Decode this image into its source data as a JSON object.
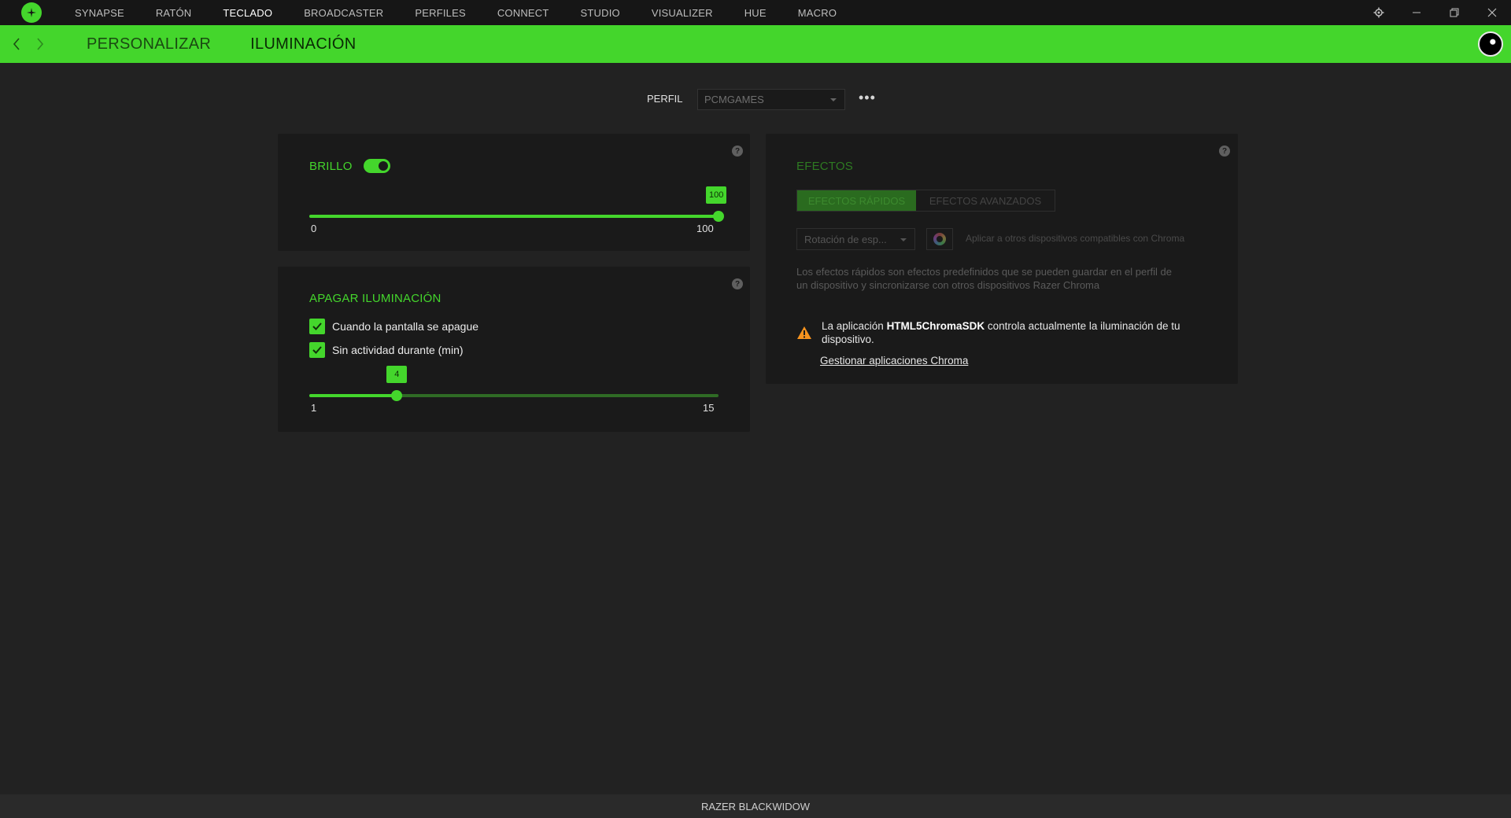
{
  "topnav": {
    "tabs": [
      {
        "label": "SYNAPSE"
      },
      {
        "label": "RATÓN"
      },
      {
        "label": "TECLADO"
      },
      {
        "label": "BROADCASTER"
      },
      {
        "label": "PERFILES"
      },
      {
        "label": "CONNECT"
      },
      {
        "label": "STUDIO"
      },
      {
        "label": "VISUALIZER"
      },
      {
        "label": "HUE"
      },
      {
        "label": "MACRO"
      }
    ],
    "active_tab": "TECLADO"
  },
  "subnav": {
    "items": [
      "PERSONALIZAR",
      "ILUMINACIÓN"
    ],
    "active": "ILUMINACIÓN"
  },
  "profile": {
    "label": "PERFIL",
    "value": "PCMGAMES"
  },
  "brightness": {
    "title": "BRILLO",
    "enabled": true,
    "value": "100",
    "min": "0",
    "max": "100",
    "fraction": 1.0
  },
  "lights_off": {
    "title": "APAGAR ILUMINACIÓN",
    "option_screen_off": "Cuando la pantalla se apague",
    "option_idle": "Sin actividad durante (min)",
    "idle_value": "4",
    "min": "1",
    "max": "15",
    "fraction": 0.214
  },
  "effects": {
    "title": "EFECTOS",
    "tab_quick": "EFECTOS RÁPIDOS",
    "tab_advanced": "EFECTOS AVANZADOS",
    "selected_effect": "Rotación de esp...",
    "apply_text": "Aplicar a otros dispositivos compatibles con Chroma",
    "description": "Los efectos rápidos son efectos predefinidos que se pueden guardar en el perfil de un dispositivo y sincronizarse con otros dispositivos Razer Chroma",
    "warning_prefix": "La aplicación ",
    "warning_app": "HTML5ChromaSDK",
    "warning_suffix": " controla actualmente la iluminación de tu dispositivo.",
    "manage_link": "Gestionar aplicaciones Chroma"
  },
  "footer": {
    "device": "RAZER BLACKWIDOW"
  },
  "colors": {
    "accent": "#44d62c",
    "background": "#222222",
    "panel": "#1a1a1a",
    "warning": "#f7931e"
  }
}
